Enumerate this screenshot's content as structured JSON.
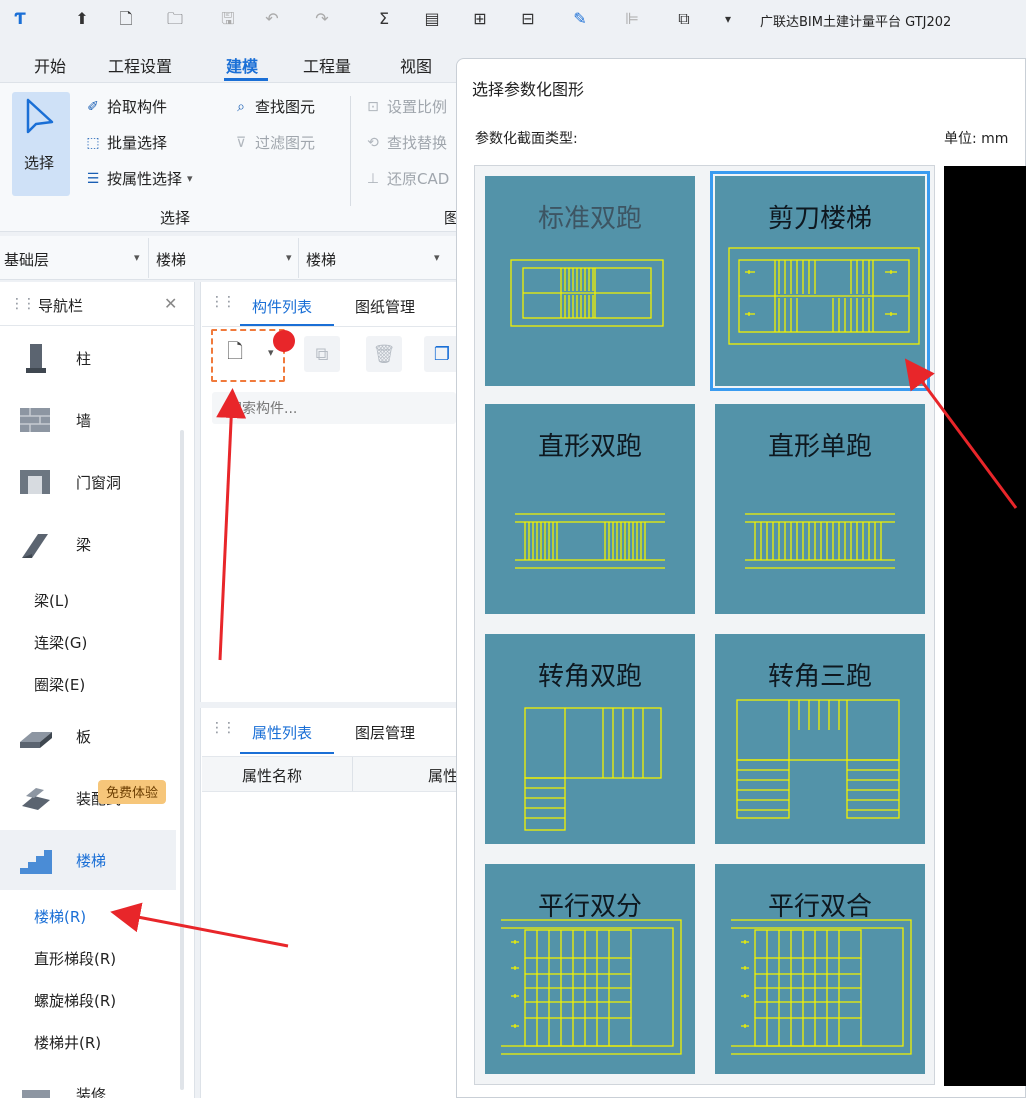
{
  "app": {
    "title": "广联达BIM土建计量平台 GTJ202"
  },
  "menu": {
    "tabs": [
      "开始",
      "工程设置",
      "建模",
      "工程量",
      "视图"
    ],
    "active": "建模"
  },
  "ribbon": {
    "select_label": "选择",
    "pick_component": "拾取构件",
    "batch_select": "批量选择",
    "select_by_attr": "按属性选择",
    "find_element": "查找图元",
    "filter_element": "过滤图元",
    "set_scale": "设置比例",
    "find_replace": "查找替换",
    "restore_cad": "还原CAD",
    "group_label": "选择",
    "group_label2": "图"
  },
  "layerbar": {
    "floor": "基础层",
    "category": "楼梯",
    "type": "楼梯"
  },
  "nav": {
    "title": "导航栏",
    "items": [
      {
        "label": "柱",
        "icon": "column-icon"
      },
      {
        "label": "墙",
        "icon": "wall-icon"
      },
      {
        "label": "门窗洞",
        "icon": "door-window-icon"
      },
      {
        "label": "梁",
        "icon": "beam-icon"
      }
    ],
    "beam_sub": [
      "梁(L)",
      "连梁(G)",
      "圈梁(E)"
    ],
    "items2": [
      {
        "label": "板",
        "icon": "slab-icon"
      },
      {
        "label": "装配式",
        "icon": "prefab-icon"
      },
      {
        "label": "楼梯",
        "icon": "stair-icon"
      }
    ],
    "stair_sub": [
      "楼梯(R)",
      "直形梯段(R)",
      "螺旋梯段(R)",
      "楼梯井(R)"
    ],
    "last_item": "装修",
    "badge": "免费体验"
  },
  "component_panel": {
    "tabs": [
      "构件列表",
      "图纸管理"
    ],
    "search_placeholder": "搜索构件..."
  },
  "property_panel": {
    "tabs": [
      "属性列表",
      "图层管理"
    ],
    "columns": [
      "属性名称",
      "属性"
    ]
  },
  "dialog": {
    "title": "选择参数化图形",
    "section_label": "参数化截面类型:",
    "unit_label": "单位: mm",
    "shapes": [
      {
        "label": "标准双跑",
        "muted": true
      },
      {
        "label": "剪刀楼梯",
        "selected": true
      },
      {
        "label": "直形双跑"
      },
      {
        "label": "直形单跑"
      },
      {
        "label": "转角双跑"
      },
      {
        "label": "转角三跑"
      },
      {
        "label": "平行双分"
      },
      {
        "label": "平行双合"
      }
    ]
  },
  "colors": {
    "accent": "#1a6fd6",
    "card_bg": "#5393a9",
    "stair_line": "#f2f200",
    "annotation": "#e8262a"
  }
}
